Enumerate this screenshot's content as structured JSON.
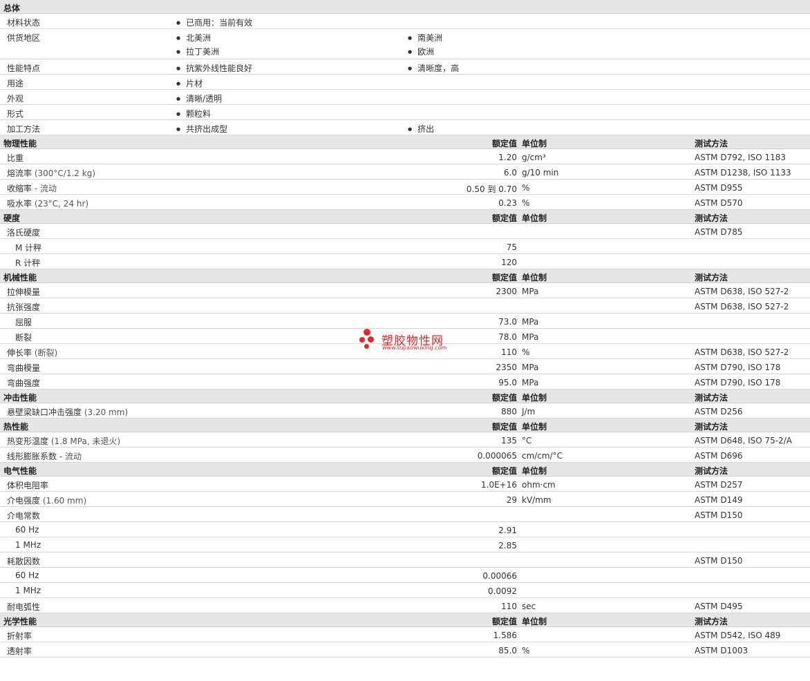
{
  "general": {
    "title": "总体",
    "rows": [
      {
        "label": "材料状态",
        "c1": [
          "已商用：当前有效"
        ],
        "c2": []
      },
      {
        "label": "供货地区",
        "c1": [
          "北美洲",
          "拉丁美洲"
        ],
        "c2": [
          "南美洲",
          "欧洲"
        ]
      },
      {
        "label": "性能特点",
        "c1": [
          "抗紫外线性能良好"
        ],
        "c2": [
          "清晰度，高"
        ]
      },
      {
        "label": "用途",
        "c1": [
          "片材"
        ],
        "c2": []
      },
      {
        "label": "外观",
        "c1": [
          "清晰/透明"
        ],
        "c2": []
      },
      {
        "label": "形式",
        "c1": [
          "颗粒料"
        ],
        "c2": []
      },
      {
        "label": "加工方法",
        "c1": [
          "共挤出成型"
        ],
        "c2": [
          "挤出"
        ]
      }
    ]
  },
  "headers": {
    "value": "额定值",
    "unit": "单位制",
    "method": "测试方法"
  },
  "sections": [
    {
      "title": "物理性能",
      "rows": [
        {
          "label": "比重",
          "cond": "",
          "value": "1.20",
          "unit": "g/cm³",
          "method": "ASTM D792, ISO 1183",
          "sub": false
        },
        {
          "label": "熔流率",
          "cond": "(300°C/1.2 kg)",
          "value": "6.0",
          "unit": "g/10 min",
          "method": "ASTM D1238, ISO 1133",
          "sub": false
        },
        {
          "label": "收缩率",
          "cond": "- 流动",
          "value": "0.50 到  0.70",
          "unit": "%",
          "method": "ASTM D955",
          "sub": false
        },
        {
          "label": "吸水率",
          "cond": "(23°C, 24 hr)",
          "value": "0.23",
          "unit": "%",
          "method": "ASTM D570",
          "sub": false
        }
      ]
    },
    {
      "title": "硬度",
      "rows": [
        {
          "label": "洛氏硬度",
          "cond": "",
          "value": "",
          "unit": "",
          "method": "ASTM D785",
          "sub": false
        },
        {
          "label": "M 计秤",
          "cond": "",
          "value": "75",
          "unit": "",
          "method": "",
          "sub": true
        },
        {
          "label": "R 计秤",
          "cond": "",
          "value": "120",
          "unit": "",
          "method": "",
          "sub": true
        }
      ]
    },
    {
      "title": "机械性能",
      "rows": [
        {
          "label": "拉伸模量",
          "cond": "",
          "value": "2300",
          "unit": "MPa",
          "method": "ASTM D638, ISO 527-2",
          "sub": false
        },
        {
          "label": "抗张强度",
          "cond": "",
          "value": "",
          "unit": "",
          "method": "ASTM D638, ISO 527-2",
          "sub": false
        },
        {
          "label": "屈服",
          "cond": "",
          "value": "73.0",
          "unit": "MPa",
          "method": "",
          "sub": true
        },
        {
          "label": "断裂",
          "cond": "",
          "value": "78.0",
          "unit": "MPa",
          "method": "",
          "sub": true
        },
        {
          "label": "伸长率",
          "cond": "(断裂)",
          "value": "110",
          "unit": "%",
          "method": "ASTM D638, ISO 527-2",
          "sub": false
        },
        {
          "label": "弯曲模量",
          "cond": "",
          "value": "2350",
          "unit": "MPa",
          "method": "ASTM D790, ISO 178",
          "sub": false
        },
        {
          "label": "弯曲强度",
          "cond": "",
          "value": "95.0",
          "unit": "MPa",
          "method": "ASTM D790, ISO 178",
          "sub": false
        }
      ]
    },
    {
      "title": "冲击性能",
      "rows": [
        {
          "label": "悬壁梁缺口冲击强度",
          "cond": "(3.20 mm)",
          "value": "880",
          "unit": "J/m",
          "method": "ASTM D256",
          "sub": false
        }
      ]
    },
    {
      "title": "热性能",
      "rows": [
        {
          "label": "热变形温度",
          "cond": "(1.8 MPa, 未退火)",
          "value": "135",
          "unit": "°C",
          "method": "ASTM D648, ISO 75-2/A",
          "sub": false
        },
        {
          "label": "线形膨胀系数",
          "cond": "- 流动",
          "value": "0.000065",
          "unit": "cm/cm/°C",
          "method": "ASTM D696",
          "sub": false
        }
      ]
    },
    {
      "title": "电气性能",
      "rows": [
        {
          "label": "体积电阻率",
          "cond": "",
          "value": "1.0E+16",
          "unit": "ohm·cm",
          "method": "ASTM D257",
          "sub": false
        },
        {
          "label": "介电强度",
          "cond": "(1.60 mm)",
          "value": "29",
          "unit": "kV/mm",
          "method": "ASTM D149",
          "sub": false
        },
        {
          "label": "介电常数",
          "cond": "",
          "value": "",
          "unit": "",
          "method": "ASTM D150",
          "sub": false
        },
        {
          "label": "60 Hz",
          "cond": "",
          "value": "2.91",
          "unit": "",
          "method": "",
          "sub": true
        },
        {
          "label": "1 MHz",
          "cond": "",
          "value": "2.85",
          "unit": "",
          "method": "",
          "sub": true
        },
        {
          "label": "耗散因数",
          "cond": "",
          "value": "",
          "unit": "",
          "method": "ASTM D150",
          "sub": false
        },
        {
          "label": "60 Hz",
          "cond": "",
          "value": "0.00066",
          "unit": "",
          "method": "",
          "sub": true
        },
        {
          "label": "1 MHz",
          "cond": "",
          "value": "0.0092",
          "unit": "",
          "method": "",
          "sub": true
        },
        {
          "label": "耐电弧性",
          "cond": "",
          "value": "110",
          "unit": "sec",
          "method": "ASTM D495",
          "sub": false
        }
      ]
    },
    {
      "title": "光学性能",
      "rows": [
        {
          "label": "折射率",
          "cond": "",
          "value": "1.586",
          "unit": "",
          "method": "ASTM D542, ISO 489",
          "sub": false
        },
        {
          "label": "透射率",
          "cond": "",
          "value": "85.0",
          "unit": "%",
          "method": "ASTM D1003",
          "sub": false
        }
      ]
    }
  ],
  "watermark": {
    "name": "塑胶物性网",
    "url": "www.sujiaowuxing.com",
    "color": "#e8262a"
  }
}
